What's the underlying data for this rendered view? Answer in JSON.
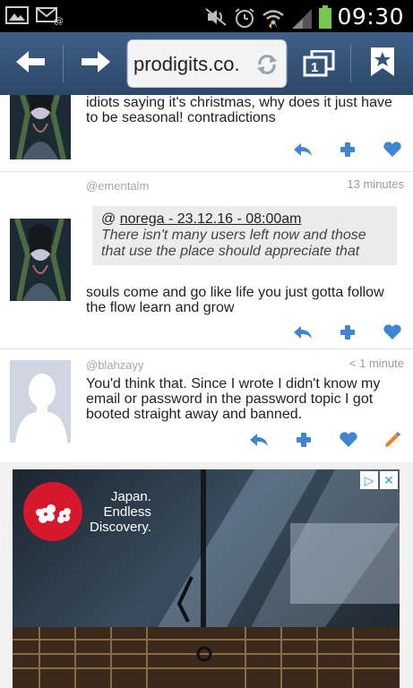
{
  "status_bar": {
    "time": "09:30",
    "icons": [
      "image-icon",
      "mail-at-icon",
      "mute-icon",
      "alarm-icon",
      "wifi-icon",
      "signal-icon",
      "battery-icon"
    ]
  },
  "browser": {
    "url": "prodigits.co.",
    "tab_count": "1",
    "icons": [
      "back-arrow-icon",
      "forward-arrow-icon",
      "reload-icon",
      "tabs-icon",
      "bookmark-icon"
    ]
  },
  "posts": [
    {
      "username": "",
      "time": "",
      "text": "idiots saying it's christmas, why does it just have to be seasonal! contradictions"
    },
    {
      "username": "@ementalm",
      "time": "13 minutes",
      "quote_prefix": "@ ",
      "quote_link": "norega - 23.12.16 - 08:00am",
      "quote_text": "There isn't many users left now and those that use the place should appreciate that",
      "text": "souls come and go like life you just gotta follow the flow learn and grow"
    },
    {
      "username": "@blahzayy",
      "time": "< 1 minute",
      "text": "You'd think that. Since I wrote I didn't know my email or password in the password topic I got booted straight away and banned."
    }
  ],
  "ad": {
    "title_line1": "Japan.",
    "title_line2": "Endless",
    "title_line3": "Discovery.",
    "adchoices_label": "▷",
    "close_label": "✕"
  },
  "colors": {
    "toolbar": "#34547a",
    "action_blue": "#3f86d1",
    "edit_orange": "#e9832b",
    "ad_red": "#d6182b"
  }
}
